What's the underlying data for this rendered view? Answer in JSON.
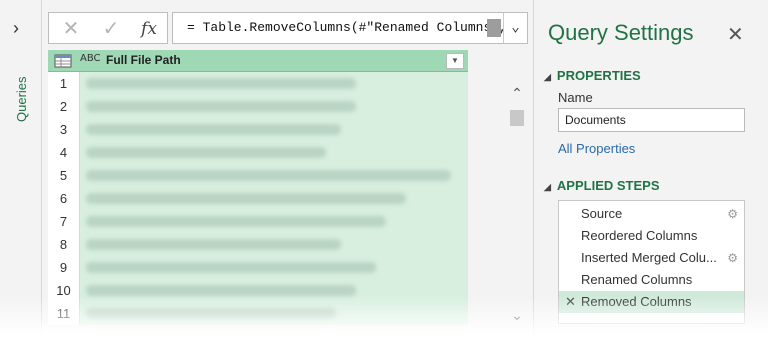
{
  "left_pane": {
    "label": "Queries",
    "expand_icon": "chevron-right-icon"
  },
  "formula_bar": {
    "cancel_icon": "close-icon",
    "commit_icon": "check-icon",
    "fx_label": "fx",
    "formula": "= Table.RemoveColumns(#\"Renamed Columns\",",
    "expand_icon": "chevron-down-icon"
  },
  "grid": {
    "column_header": "Full File Path",
    "type_icon_label": "ABC",
    "row_numbers": [
      "1",
      "2",
      "3",
      "4",
      "5",
      "6",
      "7",
      "8",
      "9",
      "10",
      "11"
    ]
  },
  "settings": {
    "title": "Query Settings",
    "close_icon": "close-icon",
    "properties_heading": "PROPERTIES",
    "name_label": "Name",
    "name_value": "Documents",
    "all_properties_link": "All Properties",
    "applied_steps_heading": "APPLIED STEPS",
    "steps": [
      {
        "label": "Source",
        "has_gear": true,
        "selected": false
      },
      {
        "label": "Reordered Columns",
        "has_gear": false,
        "selected": false
      },
      {
        "label": "Inserted Merged Colu...",
        "has_gear": true,
        "selected": false
      },
      {
        "label": "Renamed Columns",
        "has_gear": false,
        "selected": false
      },
      {
        "label": "Removed Columns",
        "has_gear": false,
        "selected": true
      }
    ]
  },
  "colors": {
    "accent_green": "#217346",
    "header_green": "#9fd8b5",
    "cell_green": "#d8efe0",
    "link_blue": "#2b6aa6"
  }
}
